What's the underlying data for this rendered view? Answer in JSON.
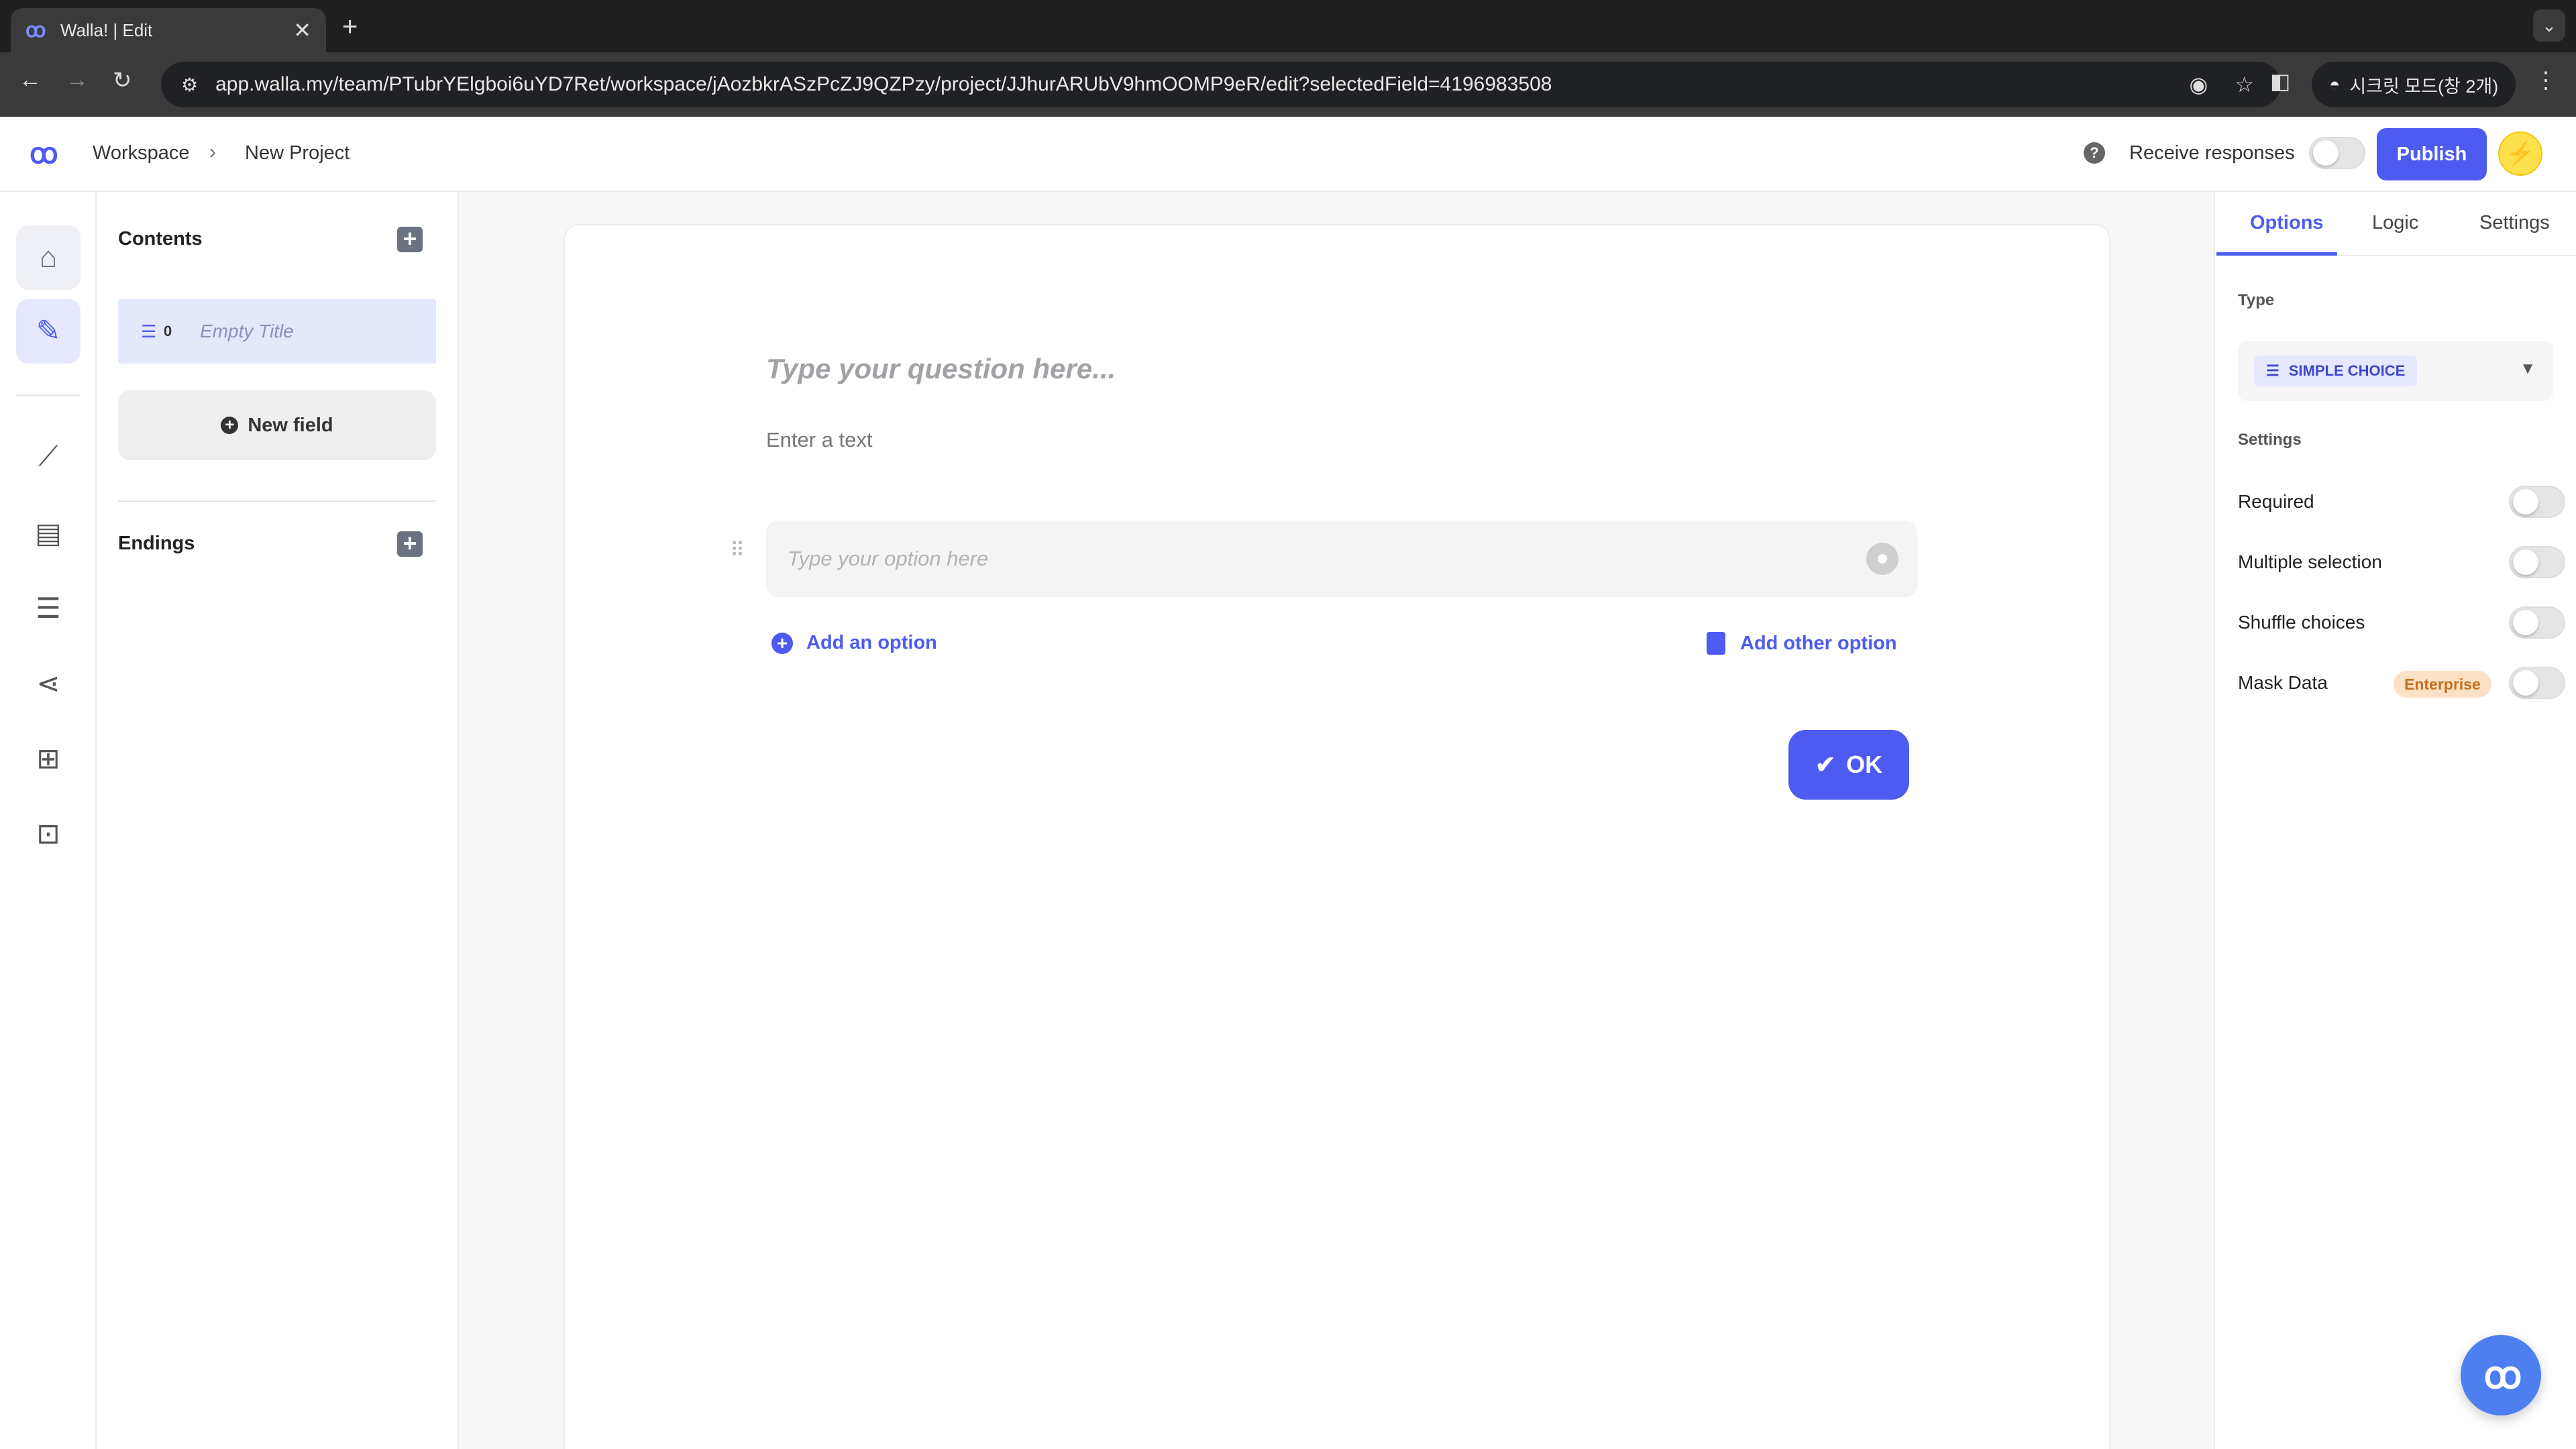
{
  "browser": {
    "tab_title": "Walla! | Edit",
    "url": "app.walla.my/team/PTubrYElgboi6uYD7Ret/workspace/jAozbkrASzPcZJ9QZPzy/project/JJhurARUbV9hmOOMP9eR/edit?selectedField=4196983508",
    "incognito_label": "시크릿 모드(창 2개)"
  },
  "header": {
    "breadcrumb": [
      "Workspace",
      "New Project"
    ],
    "receive_responses_label": "Receive responses",
    "receive_responses_on": false,
    "publish_label": "Publish"
  },
  "contents": {
    "title": "Contents",
    "fields": [
      {
        "number": "0",
        "title": "Empty Title",
        "icon": "list-icon"
      }
    ],
    "new_field_label": "New field",
    "endings_title": "Endings"
  },
  "editor": {
    "question_placeholder": "Type your question here...",
    "description_placeholder": "Enter a text",
    "option_placeholder": "Type your option here",
    "add_option_label": "Add an option",
    "add_other_option_label": "Add other option",
    "ok_label": "OK"
  },
  "right_panel": {
    "tabs": [
      "Options",
      "Logic",
      "Settings"
    ],
    "active_tab": "Options",
    "type_label": "Type",
    "type_value": "SIMPLE CHOICE",
    "settings_label": "Settings",
    "settings": [
      {
        "label": "Required",
        "on": false
      },
      {
        "label": "Multiple selection",
        "on": false
      },
      {
        "label": "Shuffle choices",
        "on": false
      },
      {
        "label": "Mask Data",
        "on": false,
        "badge": "Enterprise"
      }
    ]
  },
  "colors": {
    "accent": "#4d5bf0",
    "selected_field_bg": "#e4e8fb",
    "enterprise_badge_bg": "#fde1c6"
  }
}
